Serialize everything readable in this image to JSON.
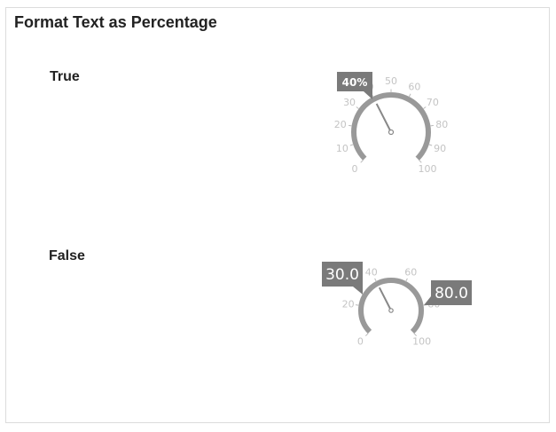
{
  "title": "Format Text as Percentage",
  "rows": [
    {
      "label": "True",
      "gauge": {
        "min": 0,
        "max": 100,
        "tick_labels": [
          "0",
          "10",
          "20",
          "30",
          "40",
          "50",
          "60",
          "70",
          "80",
          "90",
          "100"
        ],
        "value": 40,
        "value_label": "40%"
      }
    },
    {
      "label": "False",
      "gauge": {
        "min": 0,
        "max": 100,
        "tick_labels": [
          "0",
          "20",
          "40",
          "60",
          "80",
          "100"
        ],
        "value": 40,
        "range_start_label": "30.0",
        "range_end_label": "80.0"
      }
    }
  ],
  "colors": {
    "arc": "#999999",
    "ticks": "#bbbbbb",
    "tick_label": "#c4c4c4",
    "needle": "#888888",
    "tooltip_bg": "#7a7a7a",
    "tooltip_text": "#ffffff"
  }
}
